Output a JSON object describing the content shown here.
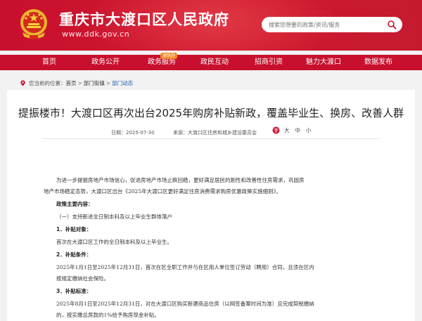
{
  "header": {
    "title": "重庆市大渡口区人民政府",
    "url": "www.ddk.gov.cn",
    "search_placeholder": "搜索您想要的政策/资讯/服务"
  },
  "nav": {
    "items": [
      {
        "label": "首页"
      },
      {
        "label": "政务公开"
      },
      {
        "label": "政务服务",
        "badge": "渝快办"
      },
      {
        "label": "政民互动"
      },
      {
        "label": "招商引资"
      },
      {
        "label": "魅力大渡口"
      },
      {
        "label": "数据发布"
      }
    ]
  },
  "breadcrumb": {
    "prefix": "您当前的位置：",
    "home": "首页",
    "sep1": ">",
    "section": "部门街镇",
    "sep2": ">",
    "current": "部门动态"
  },
  "article": {
    "title": "提振楼市！大渡口区再次出台2025年购房补贴新政，覆盖毕业生、换房、改善人群",
    "date": "日期：2025-07-30",
    "source": "来源：大渡口区住房和城乡建设委员会",
    "font_label": "字号：",
    "font_large": "大",
    "font_medium": "中",
    "font_small": "小",
    "para1_line1": "为进一步提振房地产市场信心，促进房地产市场止跌回稳，更好满足居民的刚性和改善性住房需求，巩固房",
    "para1_line2": "地产市场稳定态势，大渡口区出台《2025年大渡口区更好满足住房消费需求购房优惠政策实施细则》。",
    "section_main": "政策主要内容：",
    "item_1": "（一）支持新进全日制本科及以上毕业生群体落户",
    "sub_1": "1．补贴对象：",
    "sub_1_text": "首次在大渡口区工作的全日制本科及以上毕业生。",
    "sub_2": "2．补贴条件：",
    "sub_2_line1": "2025年1月1日至2025年12月31日，首次在区全职工作并与在区用人单位签订劳动（聘用）合同，且须在区内",
    "sub_2_line2": "按规定缴纳社会保险。",
    "sub_3": "3．补贴标准：",
    "sub_3_line1": "2025年8月1日至2025年12月31日，对在大渡口区购买新建商品住房（以网签备案时间为准）且完成契税缴纳",
    "sub_3_line2": "的，按实缴总房款的1%给予购房现金补贴。"
  },
  "colors": {
    "brand_red": "#c8102e",
    "badge_orange": "#f08a24",
    "link_blue": "#1f5fb4"
  }
}
